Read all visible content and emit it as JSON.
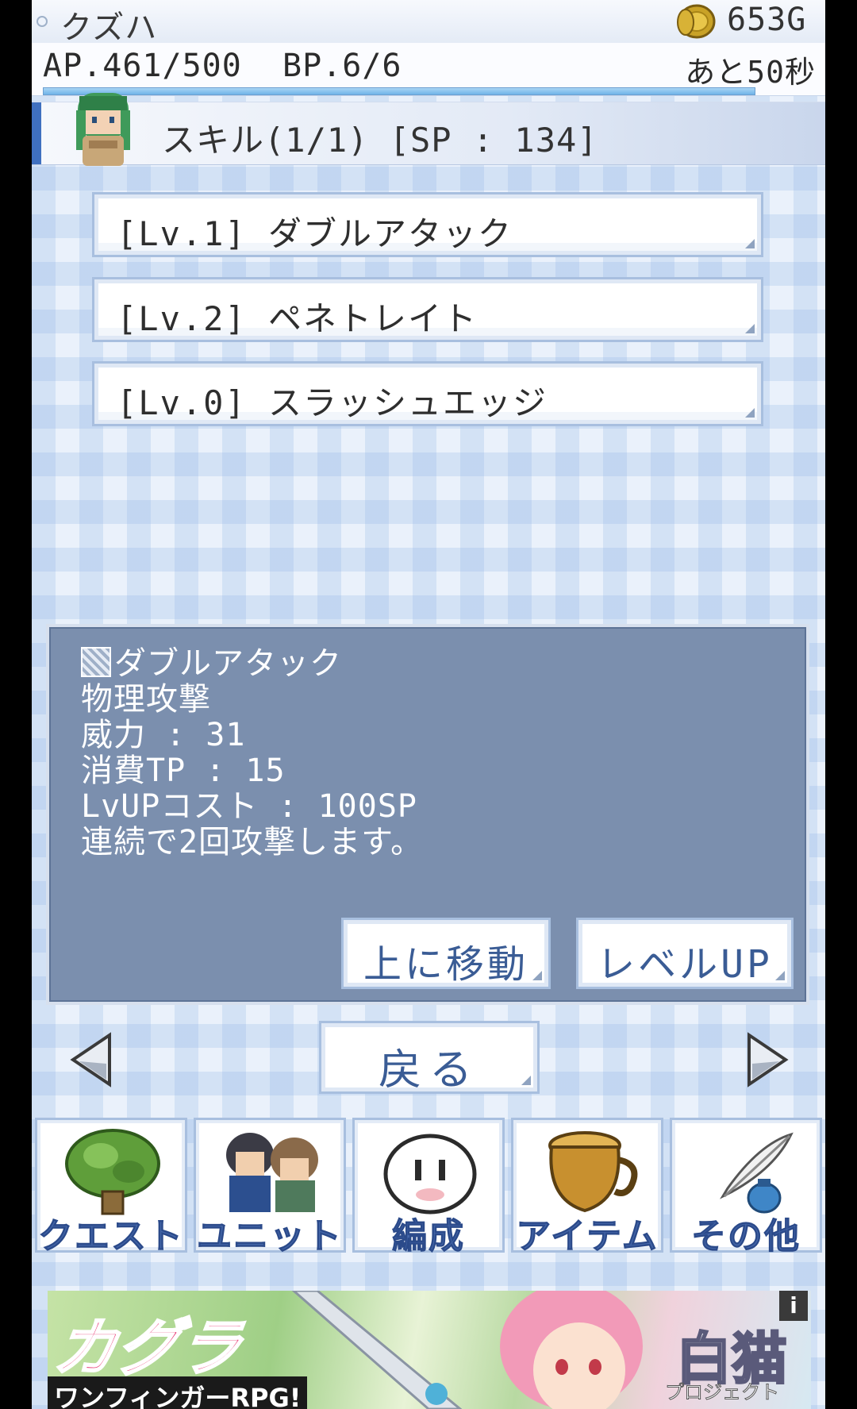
{
  "status": {
    "character_name": "クズハ",
    "gold": "653G",
    "ap": "AP.461/500",
    "bp": "BP.6/6",
    "timer": "あと50秒",
    "stamina_fraction": 0.922
  },
  "header": {
    "title": "スキル(1/1) [SP : 134]"
  },
  "skills": [
    {
      "label": "[Lv.1] ダブルアタック"
    },
    {
      "label": "[Lv.2] ペネトレイト"
    },
    {
      "label": "[Lv.0] スラッシュエッジ"
    }
  ],
  "detail": {
    "name": "ダブルアタック",
    "type": "物理攻撃",
    "power": "威力 : 31",
    "tp_cost": "消費TP : 15",
    "lvup_cost": "LvUPコスト : 100SP",
    "description": "連続で2回攻撃します。",
    "move_up_label": "上に移動",
    "level_up_label": "レベルUP"
  },
  "back_label": "戻る",
  "nav": [
    {
      "label": "クエスト",
      "icon": "tree-icon"
    },
    {
      "label": "ユニット",
      "icon": "party-icon"
    },
    {
      "label": "編成",
      "icon": "onigiri-icon"
    },
    {
      "label": "アイテム",
      "icon": "pot-icon"
    },
    {
      "label": "その他",
      "icon": "quill-icon"
    }
  ],
  "ad": {
    "brand": "カグラ",
    "tagline": "ワンフィンガーRPG!",
    "logo": "白猫",
    "logo_sub": "プロジェクト",
    "info": "i"
  }
}
